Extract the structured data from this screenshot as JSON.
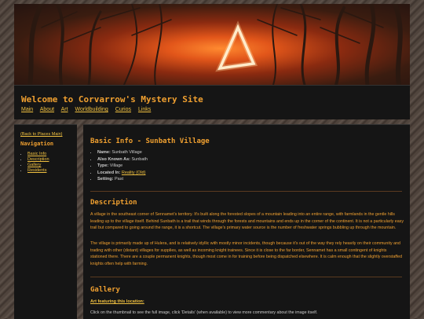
{
  "banner": {
    "image": "forest-glowing-triangle"
  },
  "header": {
    "title": "Welcome to Corvarrow's Mystery Site",
    "nav": [
      "Main",
      "About",
      "Art",
      "Worldbuilding",
      "Curios",
      "Links"
    ]
  },
  "sidebar": {
    "back_link": "(Back to Places Main)",
    "heading": "Navigation",
    "items": [
      "Basic Info",
      "Description",
      "Gallery",
      "Residents"
    ]
  },
  "main": {
    "basic_info_heading": "Basic Info - Sunbath Village",
    "fields": [
      {
        "label": "Name:",
        "value": "Sunbath Village"
      },
      {
        "label": "Also Known As:",
        "value": "Sunbath"
      },
      {
        "label": "Type:",
        "value": "Village"
      },
      {
        "label": "Located In:",
        "value": "Reality (Old)"
      },
      {
        "label": "Setting:",
        "value": "Past"
      }
    ],
    "description_heading": "Description",
    "description_p1": "A village in the southeast corner of Sennamet's territory. It's built along the forested slopes of a mountain leading into an entire range, with farmlands in the gentle hills leading up to the village itself. Behind Sunbath is a trail that winds through the forests and mountains and ends up in the corner of the continent. It is not a particularly easy trail but compared to going around the range, it is a shortcut. The village's primary water source is the number of freshwater springs bubbling up through the mountain.",
    "description_p2": "The village is primarily made up of Hulera, and is relatively idyllic with mostly minor incidents, though because it's out of the way they rely heavily on their community and trading with other (distant) villages for supplies, as well as incoming knight trainees. Since it is close to the far border, Sennamet has a small contingent of knights stationed there. There are a couple permanent knights, though most come in for training before being dispatched elsewhere. It is calm enough that the slightly overstaffed knights often help with farming.",
    "gallery_heading": "Gallery",
    "gallery_subheading": "Art featuring this location:",
    "gallery_note": "Click on the thumbnail to see the full image, click 'Details' (when available) to view more commentary about the image itself."
  },
  "colors": {
    "accent": "#f0a030",
    "link": "#f0c040",
    "panel": "#151515",
    "text": "#cccccc"
  }
}
